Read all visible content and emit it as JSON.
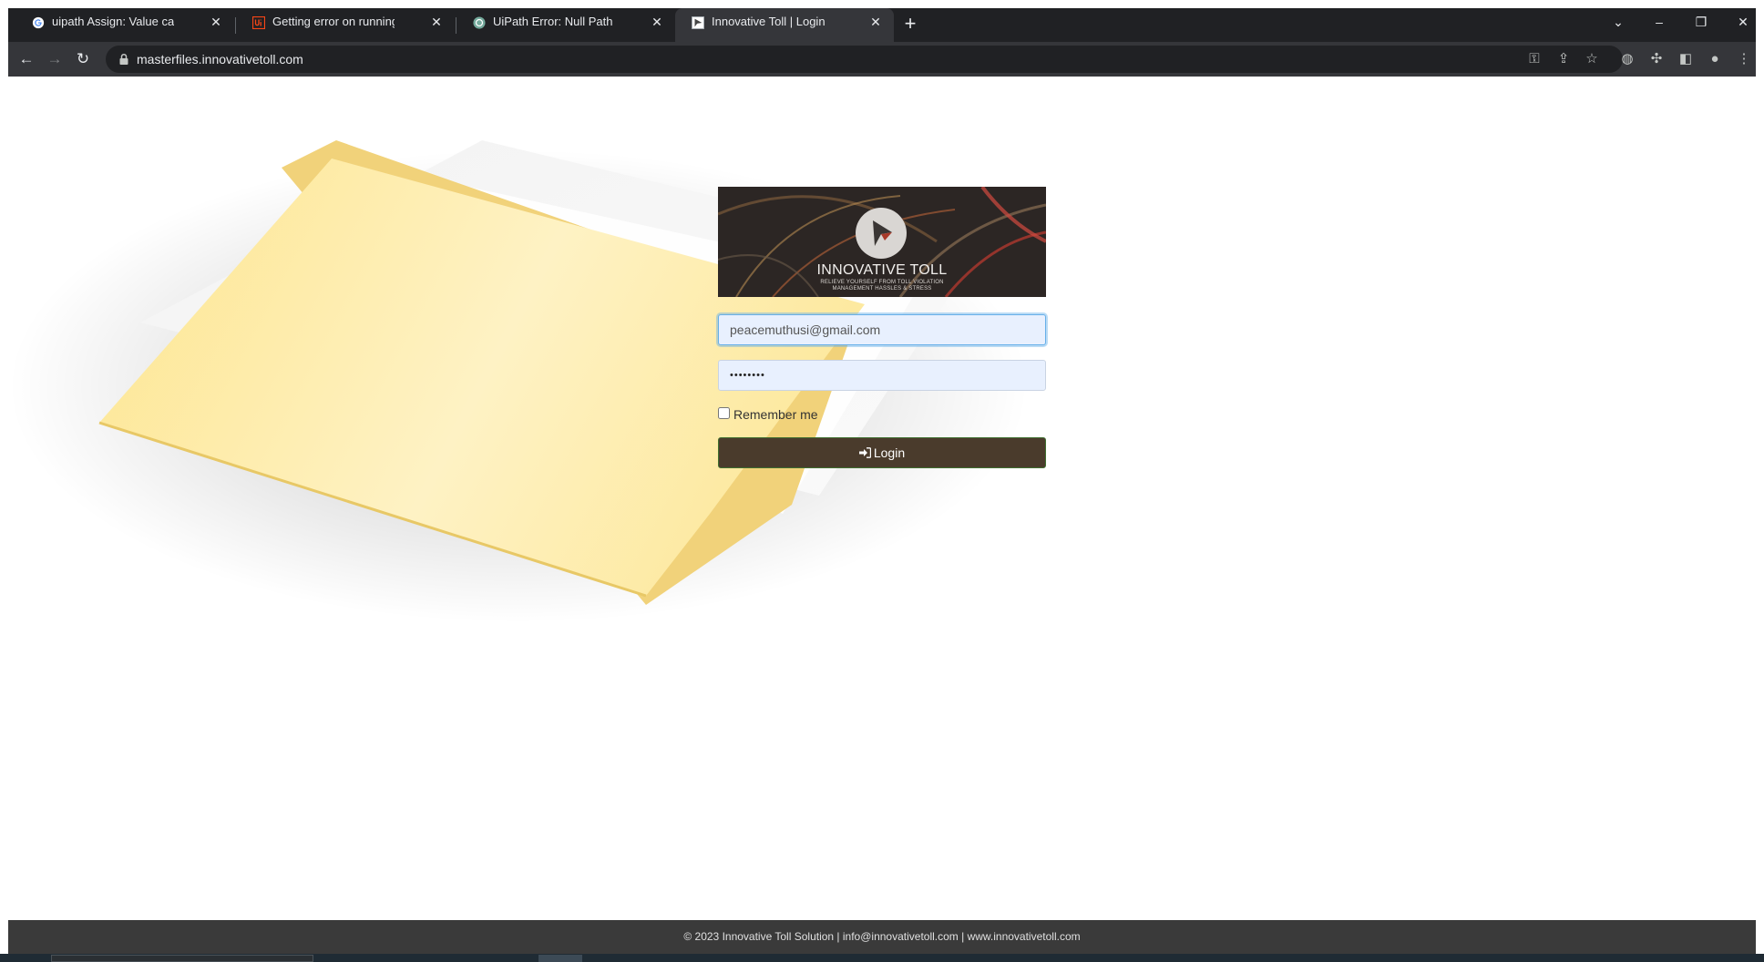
{
  "browser": {
    "tabs": [
      {
        "label": "uipath Assign: Value cannot be null",
        "favicon": "google-icon",
        "active": false
      },
      {
        "label": "Getting error on running the Robot",
        "favicon": "uipath-icon",
        "active": false
      },
      {
        "label": "UiPath Error: Null Path",
        "favicon": "chatgpt-icon",
        "active": false
      },
      {
        "label": "Innovative Toll | Login",
        "favicon": "innovative-toll-icon",
        "active": true
      }
    ],
    "url": "masterfiles.innovativetoll.com",
    "icons": [
      "back-icon",
      "forward-icon",
      "reload-icon",
      "lock-icon",
      "key-icon",
      "share-icon",
      "star-icon",
      "extension-icon",
      "puzzle-icon",
      "side-panel-icon",
      "profile-icon",
      "menu-icon",
      "new-tab-icon",
      "tab-search-icon",
      "minimize-icon",
      "restore-icon",
      "close-icon"
    ]
  },
  "login": {
    "brand_title": "INNOVATIVE TOLL",
    "brand_tagline": "RELIEVE YOURSELF FROM TOLL VIOLATION MANAGEMENT HASSLES & STRESS",
    "email_value": "peacemuthusi@gmail.com",
    "password_value": "••••••••",
    "remember_label": "Remember me",
    "login_label": "Login"
  },
  "footer": {
    "text": "© 2023 Innovative Toll Solution | info@innovativetoll.com | www.innovativetoll.com"
  },
  "colors": {
    "chrome_dark": "#202124",
    "chrome_toolbar": "#35363a",
    "login_button": "#4a3b2c",
    "folder_yellow": "#fde9a0",
    "footer_bg": "#3a3a3a"
  }
}
